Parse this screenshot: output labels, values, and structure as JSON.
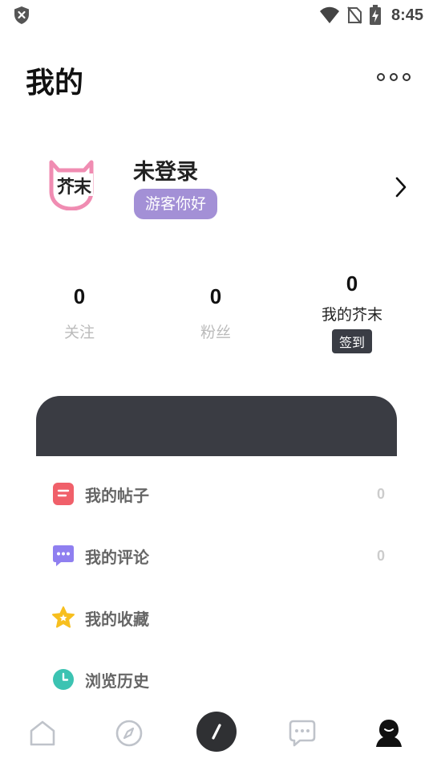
{
  "status_bar": {
    "time": "8:45",
    "icons": [
      "shield-alert-icon",
      "wifi-icon",
      "no-sim-icon",
      "battery-charging-icon"
    ]
  },
  "header": {
    "title": "我的",
    "more_icon": "more-dots-icon"
  },
  "profile": {
    "logo_text": "芥末",
    "name": "未登录",
    "badge": "游客你好",
    "arrow_icon": "chevron-right-icon"
  },
  "stats": {
    "following": {
      "value": "0",
      "label": "关注"
    },
    "fans": {
      "value": "0",
      "label": "粉丝"
    },
    "jiemo": {
      "value": "0",
      "label": "我的芥末",
      "action": "签到"
    }
  },
  "menu": [
    {
      "label": "我的帖子",
      "count": "0",
      "icon": "posts-icon",
      "color": "#f0606a"
    },
    {
      "label": "我的评论",
      "count": "0",
      "icon": "comment-icon",
      "color": "#8f7ff0"
    },
    {
      "label": "我的收藏",
      "count": "",
      "icon": "star-icon",
      "color": "#f7bf1f"
    },
    {
      "label": "浏览历史",
      "count": "",
      "icon": "clock-icon",
      "color": "#3cc3b2"
    }
  ],
  "tabbar": {
    "items": [
      "home-icon",
      "discover-icon",
      "post-icon",
      "message-icon",
      "profile-icon"
    ],
    "active": "profile-icon"
  },
  "colors": {
    "badge": "#a390d6",
    "dark_card": "#3a3c43",
    "checkin_bg": "#3a3d45",
    "logo_pink": "#f08cb2"
  }
}
